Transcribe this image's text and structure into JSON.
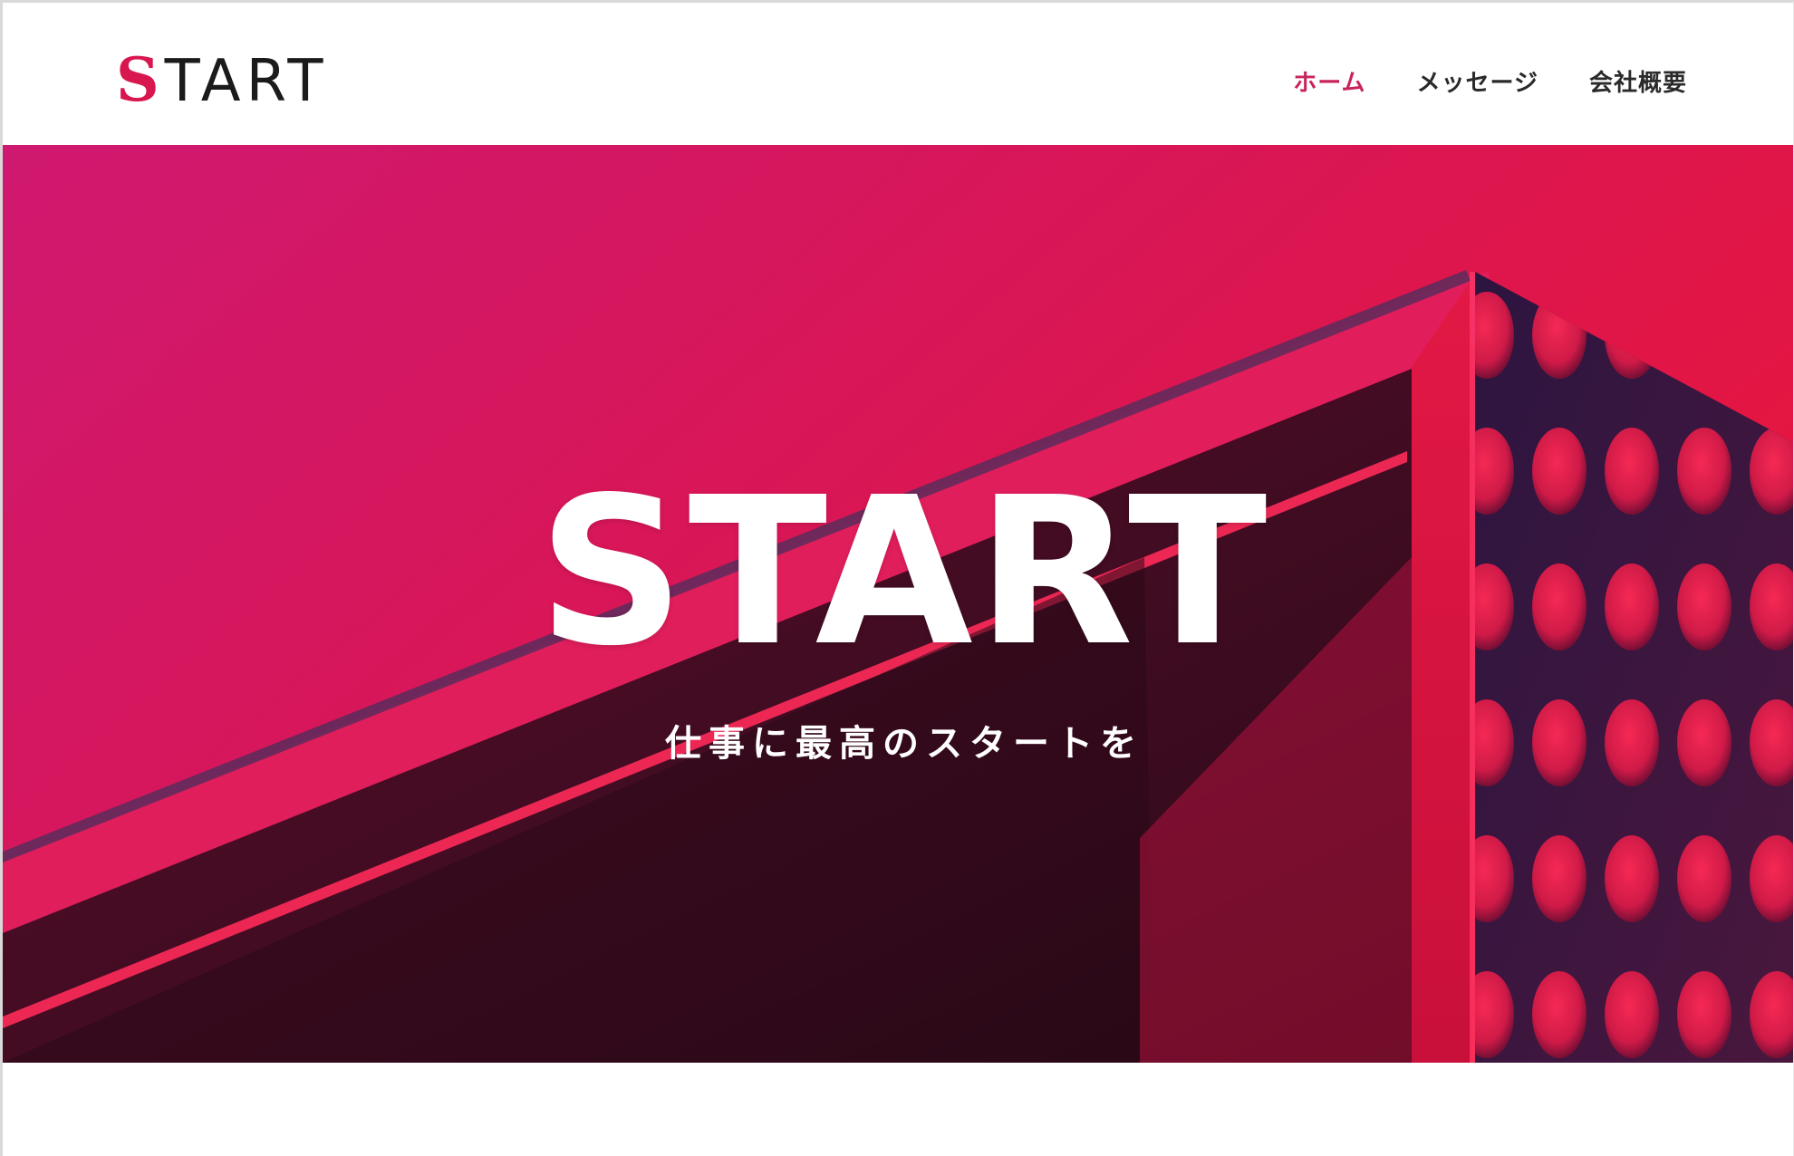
{
  "header": {
    "logo": {
      "first_letter": "S",
      "rest": "TART"
    },
    "nav": [
      {
        "label": "ホーム",
        "active": true
      },
      {
        "label": "メッセージ",
        "active": false
      },
      {
        "label": "会社概要",
        "active": false
      }
    ]
  },
  "hero": {
    "title": "START",
    "subtitle": "仕事に最高のスタートを"
  },
  "colors": {
    "accent": "#c8245a",
    "logo_s": "#d8174f",
    "hero_magenta": "#d2186a",
    "hero_red": "#e8163f",
    "facade_navy": "#3a1742"
  }
}
